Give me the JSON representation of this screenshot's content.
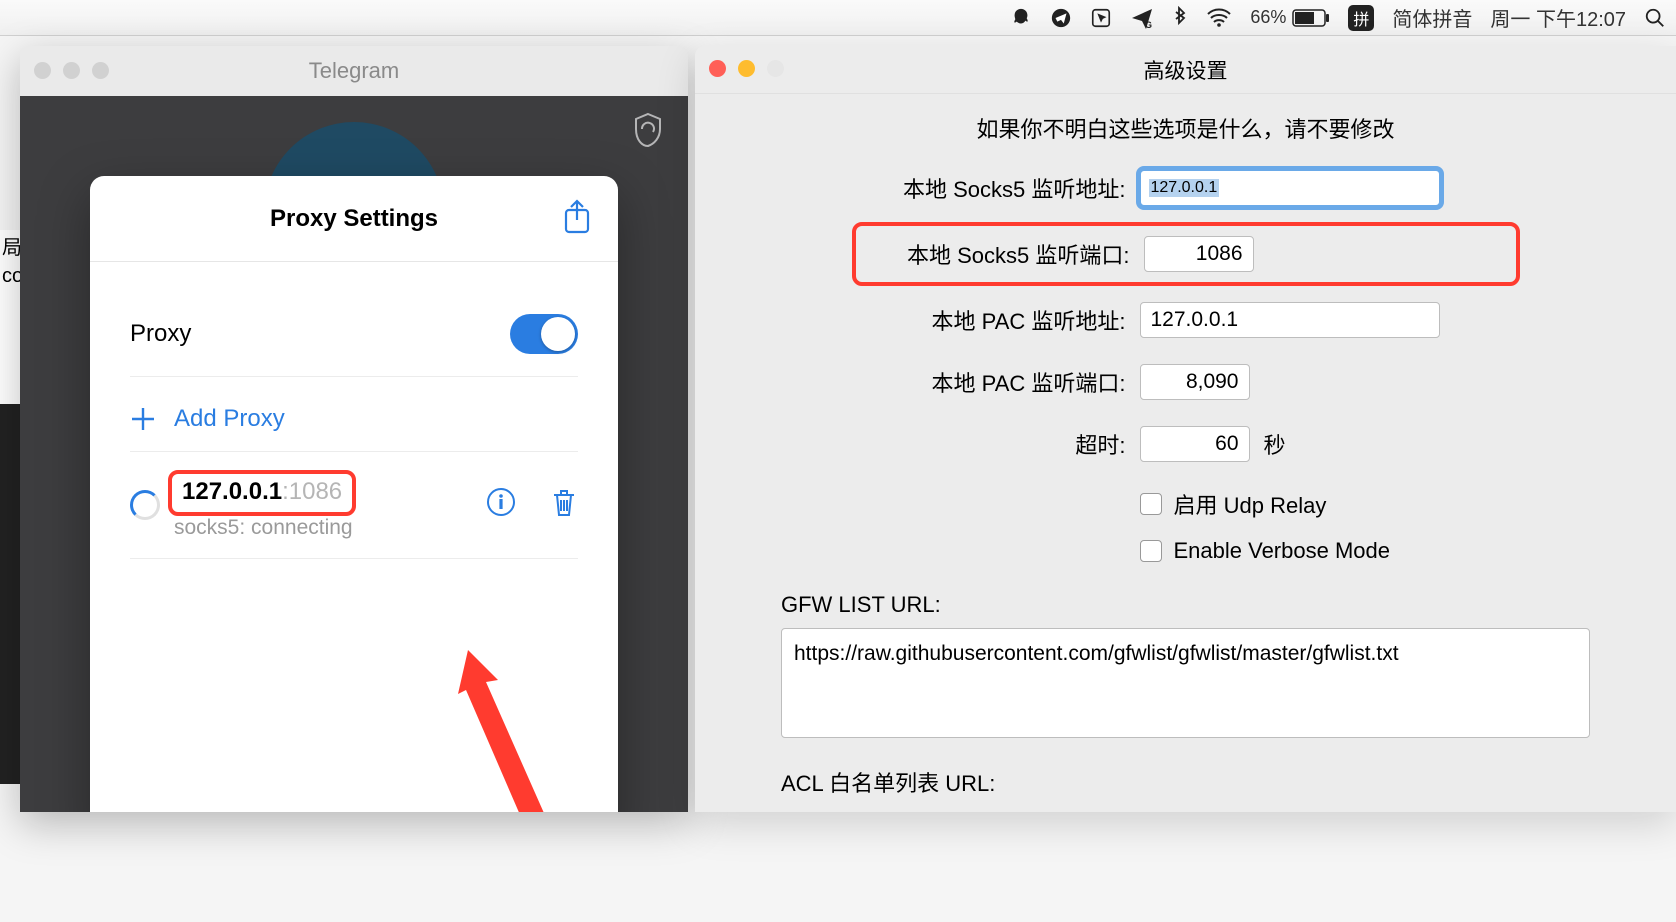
{
  "menubar": {
    "battery_pct": "66%",
    "ime_badge": "拼",
    "ime_label": "简体拼音",
    "datetime": "周一 下午12:07"
  },
  "left_sliver": {
    "line1": "局",
    "line2": "co"
  },
  "telegram": {
    "title": "Telegram",
    "sheet_title": "Proxy Settings",
    "proxy_label": "Proxy",
    "add_proxy": "Add Proxy",
    "entry_host": "127.0.0.1",
    "entry_port": ":1086",
    "entry_status": "socks5: connecting"
  },
  "advanced": {
    "title": "高级设置",
    "warning": "如果你不明白这些选项是什么，请不要修改",
    "rows": {
      "socks_addr_label": "本地 Socks5 监听地址:",
      "socks_addr_value": "127.0.0.1",
      "socks_port_label": "本地 Socks5 监听端口:",
      "socks_port_value": "1086",
      "pac_addr_label": "本地 PAC 监听地址:",
      "pac_addr_value": "127.0.0.1",
      "pac_port_label": "本地 PAC 监听端口:",
      "pac_port_value": "8,090",
      "timeout_label": "超时:",
      "timeout_value": "60",
      "timeout_suffix": "秒",
      "udp_relay": "启用 Udp Relay",
      "verbose": "Enable Verbose Mode"
    },
    "gfw_label": "GFW LIST URL:",
    "gfw_value": "https://raw.githubusercontent.com/gfwlist/gfwlist/master/gfwlist.txt",
    "acl_label": "ACL 白名单列表 URL:"
  }
}
